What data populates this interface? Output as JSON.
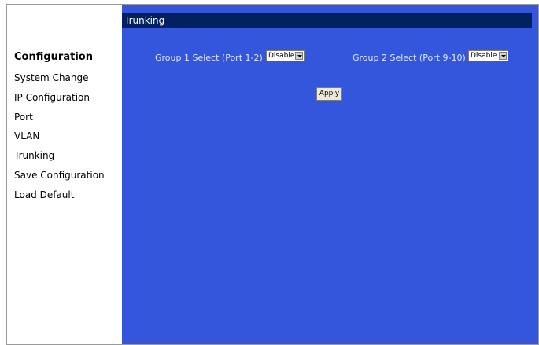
{
  "sidebar": {
    "heading": "Configuration",
    "items": [
      {
        "label": "System Change"
      },
      {
        "label": "IP Configuration"
      },
      {
        "label": "Port"
      },
      {
        "label": "VLAN"
      },
      {
        "label": "Trunking"
      },
      {
        "label": "Save Configuration"
      },
      {
        "label": "Load Default"
      }
    ]
  },
  "main": {
    "title": "Trunking",
    "group1": {
      "label": "Group 1 Select (Port 1-2)",
      "value": "Disable"
    },
    "group2": {
      "label": "Group 2 Select (Port 9-10)",
      "value": "Disable"
    },
    "apply_label": "Apply"
  },
  "colors": {
    "panel_bg": "#3456dc",
    "title_bg": "#04215f"
  }
}
